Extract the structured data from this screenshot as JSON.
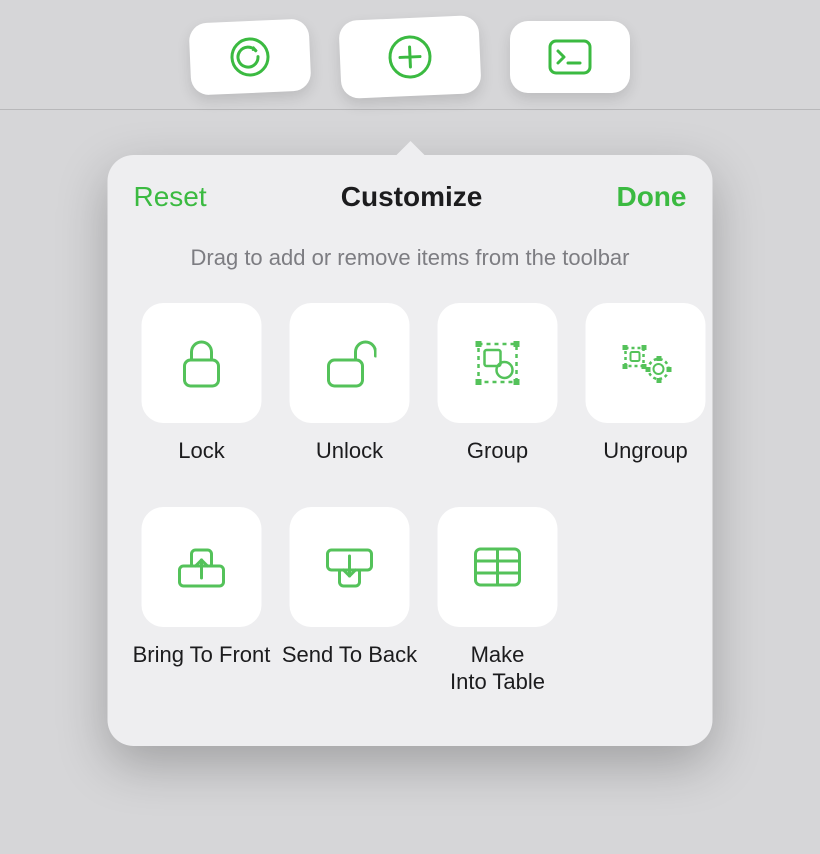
{
  "colors": {
    "accent": "#3bba41",
    "tile": "#ffffff",
    "popover": "#eeeef0"
  },
  "toolbar": {
    "items": [
      {
        "name": "undo-icon"
      },
      {
        "name": "add-icon"
      },
      {
        "name": "terminal-icon"
      }
    ]
  },
  "popover": {
    "reset_label": "Reset",
    "title": "Customize",
    "done_label": "Done",
    "subtitle": "Drag to add or remove items from the toolbar",
    "items": [
      {
        "name": "lock",
        "label": "Lock",
        "icon": "lock-icon"
      },
      {
        "name": "unlock",
        "label": "Unlock",
        "icon": "unlock-icon"
      },
      {
        "name": "group",
        "label": "Group",
        "icon": "group-icon"
      },
      {
        "name": "ungroup",
        "label": "Ungroup",
        "icon": "ungroup-icon"
      },
      {
        "name": "bring-front",
        "label": "Bring To Front",
        "icon": "bring-to-front-icon"
      },
      {
        "name": "send-back",
        "label": "Send To Back",
        "icon": "send-to-back-icon"
      },
      {
        "name": "make-table",
        "label": "Make\nInto Table",
        "icon": "table-icon"
      }
    ]
  }
}
